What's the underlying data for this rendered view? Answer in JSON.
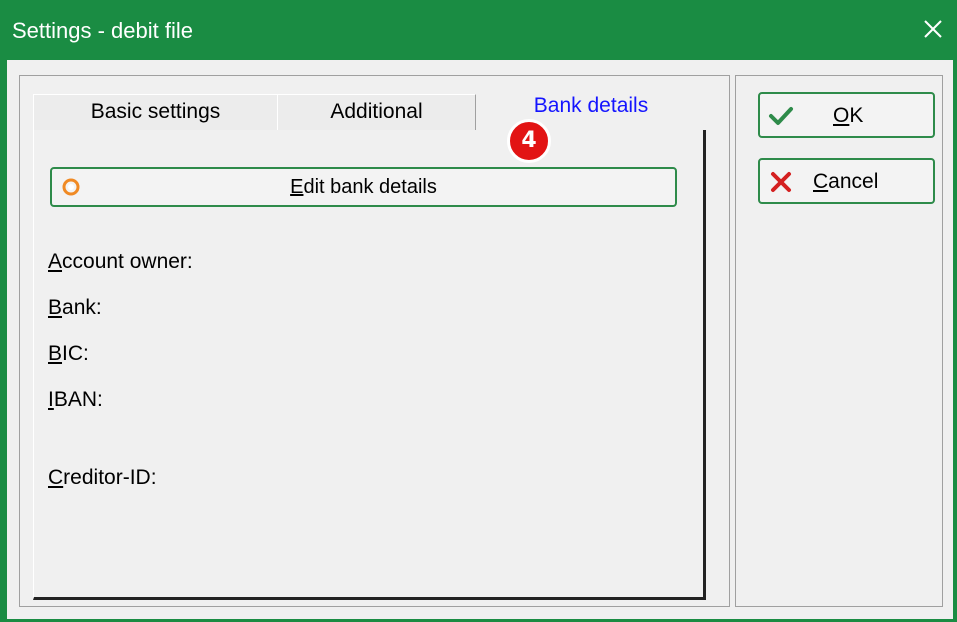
{
  "window": {
    "title": "Settings - debit file"
  },
  "tabs": [
    {
      "label": "Basic settings",
      "active": false
    },
    {
      "label": "Additional",
      "active": false
    },
    {
      "label": "Bank details",
      "active": true
    }
  ],
  "step_badge": "4",
  "edit_button": {
    "mnemonic": "E",
    "rest": "dit bank details"
  },
  "fields": [
    {
      "mnemonic": "A",
      "rest": "ccount owner:"
    },
    {
      "mnemonic": "B",
      "rest": "ank:"
    },
    {
      "mnemonic": "B",
      "rest": "IC:"
    },
    {
      "mnemonic": "I",
      "rest": "BAN:"
    },
    {
      "mnemonic": "C",
      "rest": "reditor-ID:"
    }
  ],
  "buttons": {
    "ok": {
      "mnemonic": "O",
      "rest": "K"
    },
    "cancel": {
      "mnemonic": "C",
      "rest": "ancel"
    }
  },
  "colors": {
    "titlebar": "#1a8c43",
    "active_tab_text": "#1414ff",
    "badge": "#e21414",
    "ok_icon": "#2e8b4a",
    "cancel_icon": "#d42020"
  },
  "icons": {
    "close": "close-icon",
    "ok": "check-icon",
    "cancel": "x-icon",
    "edit": "radio-icon"
  }
}
